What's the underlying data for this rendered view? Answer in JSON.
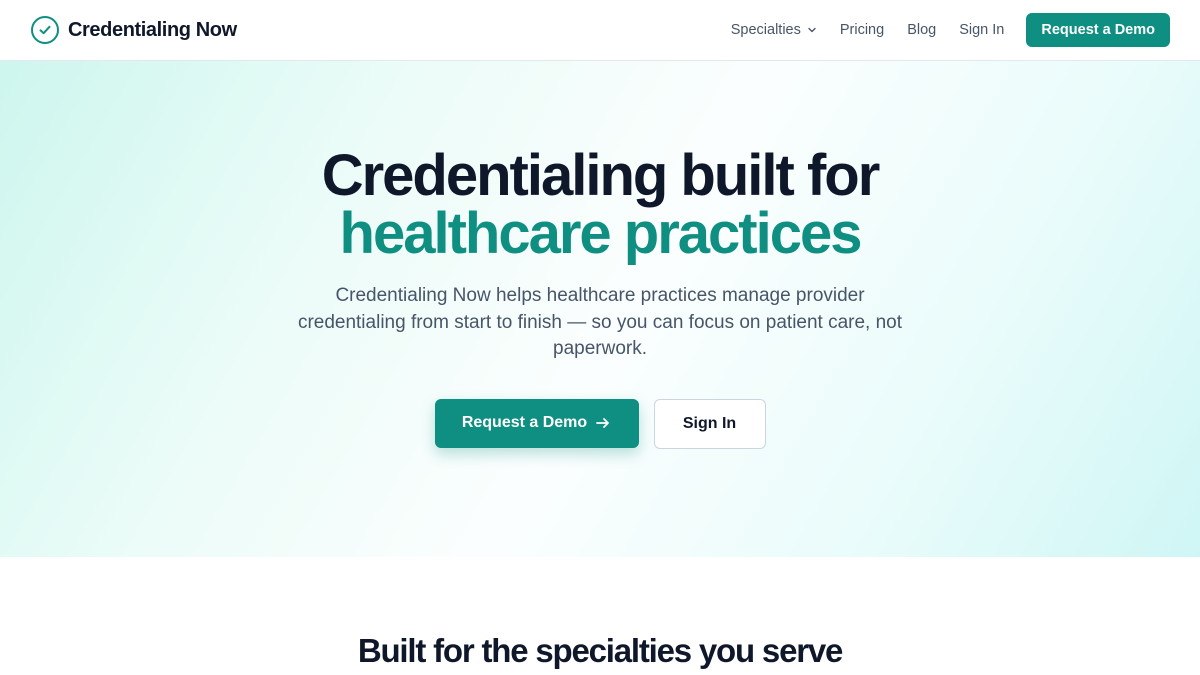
{
  "brand": {
    "name": "Credentialing Now",
    "icon": "check-circle-icon",
    "accent_color": "#0f8f82"
  },
  "nav": {
    "specialties": "Specialties",
    "pricing": "Pricing",
    "blog": "Blog",
    "sign_in": "Sign In",
    "cta": "Request a Demo"
  },
  "hero": {
    "title_line1": "Credentialing built for",
    "title_line2": "healthcare practices",
    "subtitle": "Credentialing Now helps healthcare practices manage provider credentialing from start to finish — so you can focus on patient care, not paperwork.",
    "primary_cta": "Request a Demo",
    "secondary_cta": "Sign In"
  },
  "specialties_section": {
    "title": "Built for the specialties you serve"
  }
}
